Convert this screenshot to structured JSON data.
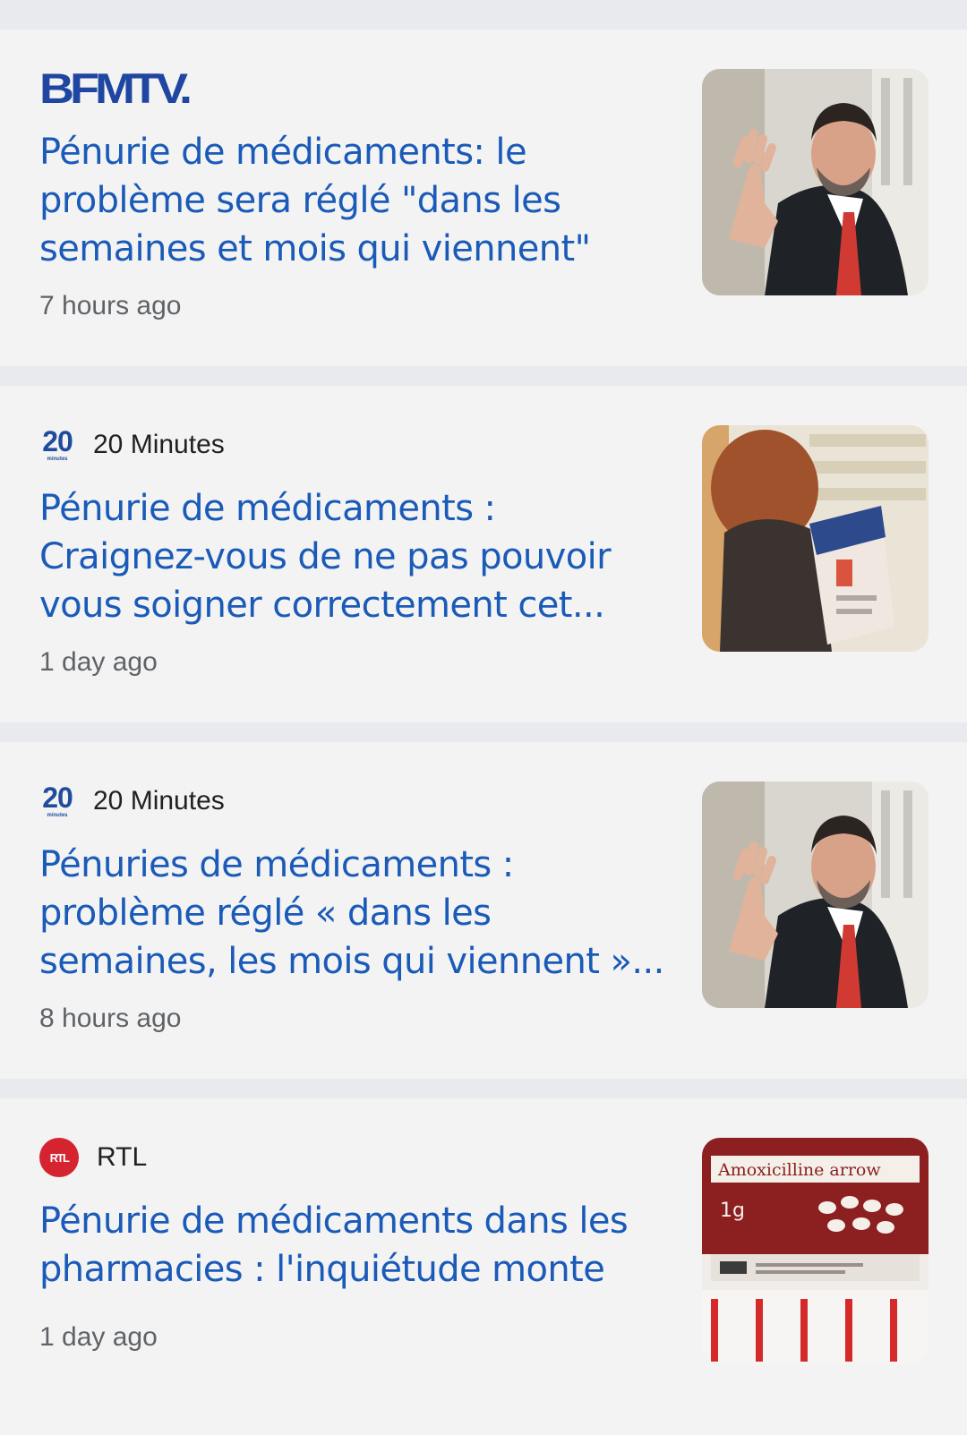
{
  "articles": [
    {
      "source": "BFMTV.",
      "source_logo": "BFMTV.",
      "headline": "Pénurie de médicaments: le problème sera réglé \"dans les semaines et mois qui viennent\"",
      "time": "7 hours ago",
      "thumbnail": "man-waving-photo"
    },
    {
      "source": "20 Minutes",
      "source_logo": "20",
      "source_logo_sub": "minutes",
      "headline": "Pénurie de médicaments : Craignez-vous de ne pas pouvoir vous soigner correctement cet...",
      "time": "1 day ago",
      "thumbnail": "pharmacy-box-photo"
    },
    {
      "source": "20 Minutes",
      "source_logo": "20",
      "source_logo_sub": "minutes",
      "headline": "Pénuries de médicaments : problème réglé « dans les semaines, les mois qui viennent »...",
      "time": "8 hours ago",
      "thumbnail": "man-waving-photo"
    },
    {
      "source": "RTL",
      "source_logo": "RTL",
      "headline": "Pénurie de médicaments dans les pharmacies : l'inquiétude monte",
      "time": "1 day ago",
      "thumbnail": "amoxicilline-box-photo",
      "thumbnail_text": "Amoxicilline arrow",
      "thumbnail_dose": "1g"
    }
  ],
  "colors": {
    "headline": "#1a5ab8",
    "bfmtv": "#1f47a1",
    "twenty_minutes": "#1f4c9c",
    "rtl": "#d5232f"
  }
}
